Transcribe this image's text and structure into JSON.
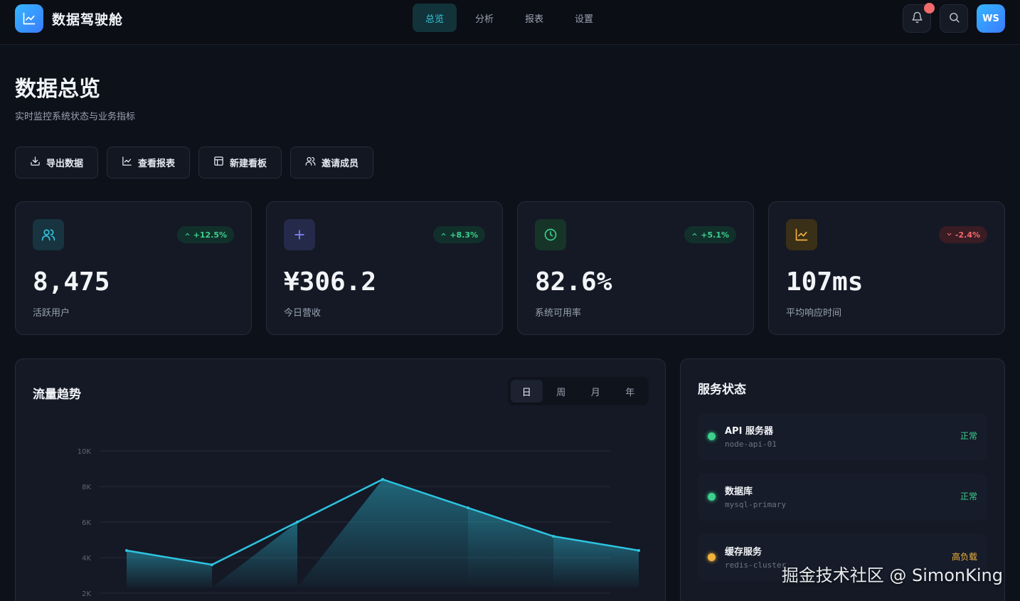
{
  "header": {
    "brand": "数据驾驶舱",
    "nav": [
      {
        "label": "总览",
        "active": true
      },
      {
        "label": "分析",
        "active": false
      },
      {
        "label": "报表",
        "active": false
      },
      {
        "label": "设置",
        "active": false
      }
    ],
    "avatar": "WS"
  },
  "page": {
    "title": "数据总览",
    "subtitle": "实时监控系统状态与业务指标"
  },
  "actions": [
    {
      "label": "导出数据",
      "icon": "download-icon"
    },
    {
      "label": "查看报表",
      "icon": "chart-line-icon"
    },
    {
      "label": "新建看板",
      "icon": "layout-icon"
    },
    {
      "label": "邀请成员",
      "icon": "users-icon"
    }
  ],
  "stats": [
    {
      "value": "8,475",
      "label": "活跃用户",
      "change": "+12.5%",
      "trend": "up",
      "icon": "users-icon",
      "color": "#35c6e0"
    },
    {
      "value": "¥306.2",
      "label": "今日营收",
      "change": "+8.3%",
      "trend": "up",
      "icon": "plus-icon",
      "color": "#7f86ff"
    },
    {
      "value": "82.6%",
      "label": "系统可用率",
      "change": "+5.1%",
      "trend": "up",
      "icon": "clock-icon",
      "color": "#3ccf8e"
    },
    {
      "value": "107ms",
      "label": "平均响应时间",
      "change": "-2.4%",
      "trend": "down",
      "icon": "chart-line-icon",
      "color": "#f2b33d"
    }
  ],
  "chart": {
    "title": "流量趋势",
    "ranges": [
      "日",
      "周",
      "月",
      "年"
    ],
    "active_range": "日"
  },
  "chart_data": {
    "type": "area",
    "title": "流量趋势",
    "xlabel": "",
    "ylabel": "",
    "y_ticks": [
      "10K",
      "8K",
      "6K",
      "4K",
      "2K"
    ],
    "tick_values": [
      10000,
      8000,
      6000,
      4000,
      2000
    ],
    "ylim": [
      0,
      10000
    ],
    "x": [
      0,
      1,
      2,
      3,
      4,
      5,
      6
    ],
    "values": [
      4400,
      3600,
      6000,
      8400,
      6800,
      5200,
      4400
    ],
    "color": "#2ec4e0",
    "grid": true
  },
  "services": {
    "title": "服务状态",
    "items": [
      {
        "name": "API 服务器",
        "host": "node-api-01",
        "status": "正常",
        "color": "#3ccf8e"
      },
      {
        "name": "数据库",
        "host": "mysql-primary",
        "status": "正常",
        "color": "#3ccf8e"
      },
      {
        "name": "缓存服务",
        "host": "redis-cluster",
        "status": "高负载",
        "color": "#f2b33d"
      }
    ]
  },
  "watermark": "掘金技术社区 @ SimonKing"
}
